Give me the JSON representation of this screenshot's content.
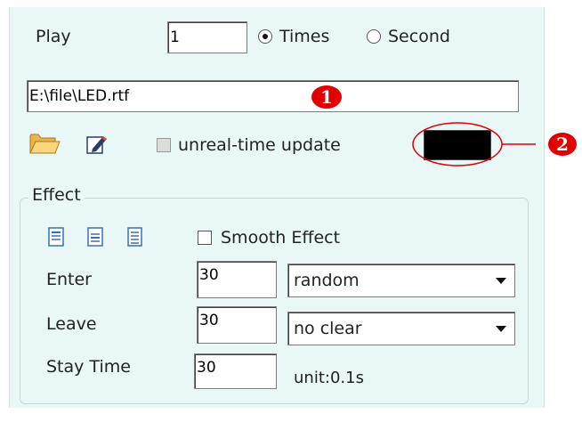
{
  "play": {
    "label": "Play",
    "count_value": "1",
    "mode_times_label": "Times",
    "mode_second_label": "Second",
    "selected_mode": "times"
  },
  "file": {
    "path_value": "E:\\file\\LED.rtf",
    "realtime_update_label": "unreal-time update",
    "color_swatch": "#000000"
  },
  "annotations": {
    "marker_1": "1",
    "marker_2": "2",
    "marker_color": "#e00000"
  },
  "effect": {
    "group_label": "Effect",
    "smooth_label": "Smooth Effect",
    "enter_label": "Enter",
    "enter_value": "30",
    "enter_mode": "random",
    "leave_label": "Leave",
    "leave_value": "30",
    "leave_mode": "no clear",
    "stay_label": "Stay Time",
    "stay_value": "30",
    "unit_label": "unit:0.1s"
  },
  "colors": {
    "panel_bg": "#e9f8f7",
    "icon_blue": "#3a6fb0"
  }
}
